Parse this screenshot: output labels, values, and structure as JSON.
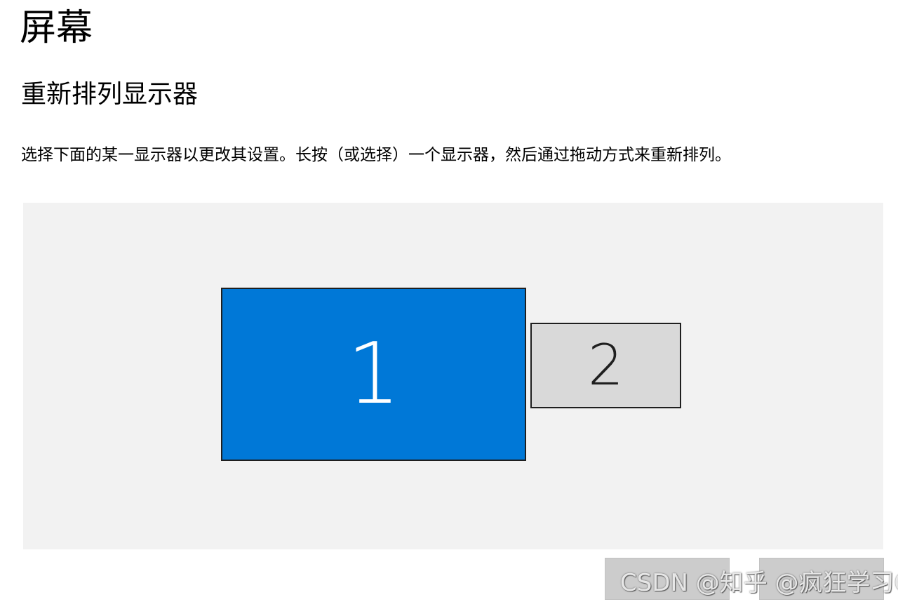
{
  "page": {
    "title": "屏幕"
  },
  "arrange": {
    "section_title": "重新排列显示器",
    "description": "选择下面的某一显示器以更改其设置。长按（或选择）一个显示器，然后通过拖动方式来重新排列。"
  },
  "monitors": [
    {
      "label": "1",
      "selected": true,
      "color": "#0078d7"
    },
    {
      "label": "2",
      "selected": false,
      "color": "#d9d9d9"
    }
  ],
  "buttons": {
    "identify": "",
    "detect": ""
  },
  "watermark": {
    "text": "CSDN @知乎 @疯狂学习GIS"
  },
  "colors": {
    "accent": "#0078d7",
    "arrange_background": "#f2f2f2",
    "button_background": "#cccccc"
  }
}
